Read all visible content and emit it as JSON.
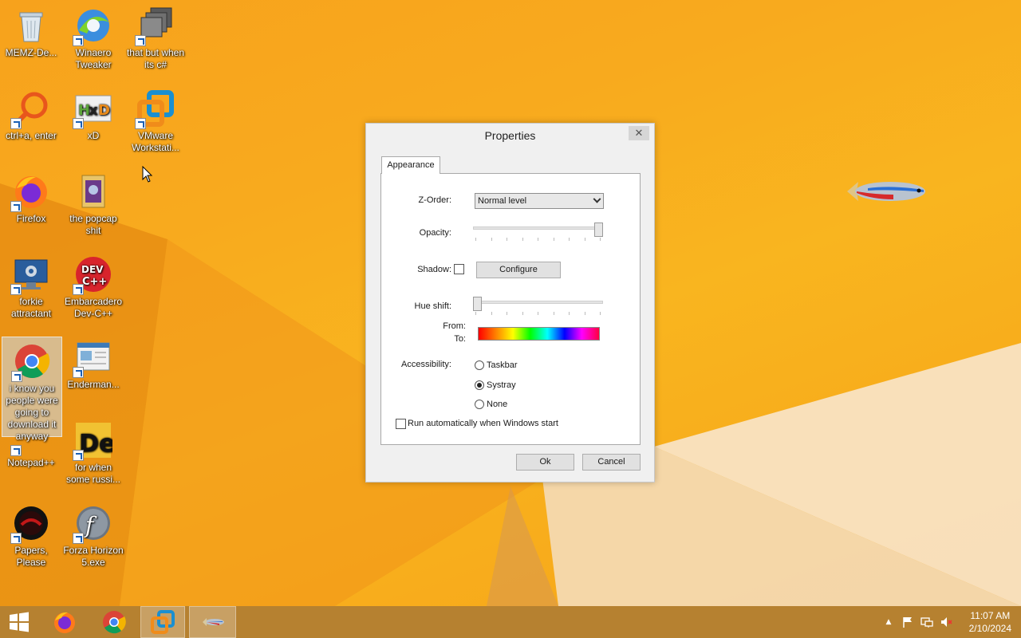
{
  "desktop": {
    "icons": [
      {
        "label": "MEMZ-De..."
      },
      {
        "label": "Winaero Tweaker"
      },
      {
        "label": "that but when its c#"
      },
      {
        "label": "ctrl+a, enter"
      },
      {
        "label": "xD"
      },
      {
        "label": "VMware Workstati..."
      },
      {
        "label": "Firefox"
      },
      {
        "label": "the popcap shit"
      },
      {
        "label": "forkie attractant"
      },
      {
        "label": "Embarcadero Dev-C++"
      },
      {
        "label": "i know you people were going to download it anyway"
      },
      {
        "label": "Enderman..."
      },
      {
        "label": "Notepad++"
      },
      {
        "label": "for when some russi..."
      },
      {
        "label": "Papers, Please"
      },
      {
        "label": "Forza Horizon 5.exe"
      }
    ]
  },
  "dialog": {
    "title": "Properties",
    "close_glyph": "✕",
    "tab": "Appearance",
    "zorder_label": "Z-Order:",
    "zorder_value": "Normal level",
    "opacity_label": "Opacity:",
    "opacity_level": 1.0,
    "shadow_label": "Shadow:",
    "shadow_checked": false,
    "configure_label": "Configure",
    "hue_label": "Hue shift:",
    "hue_level": 0.0,
    "from_label": "From:",
    "to_label": "To:",
    "accessibility_label": "Accessibility:",
    "options": [
      "Taskbar",
      "Systray",
      "None"
    ],
    "selected_option": "Systray",
    "autorun_label": "Run automatically when Windows start",
    "autorun_checked": false,
    "ok_label": "Ok",
    "cancel_label": "Cancel"
  },
  "taskbar": {
    "items": [
      "start-button",
      "firefox",
      "chrome",
      "vmware",
      "fish-app"
    ],
    "clock_time": "11:07 AM",
    "clock_date": "2/10/2024",
    "tray_chevron": "▲"
  },
  "colors": {
    "wallpaper": "#f8aa1e",
    "taskbar": "#b0761e",
    "dialog_bg": "#f0f0f0"
  }
}
